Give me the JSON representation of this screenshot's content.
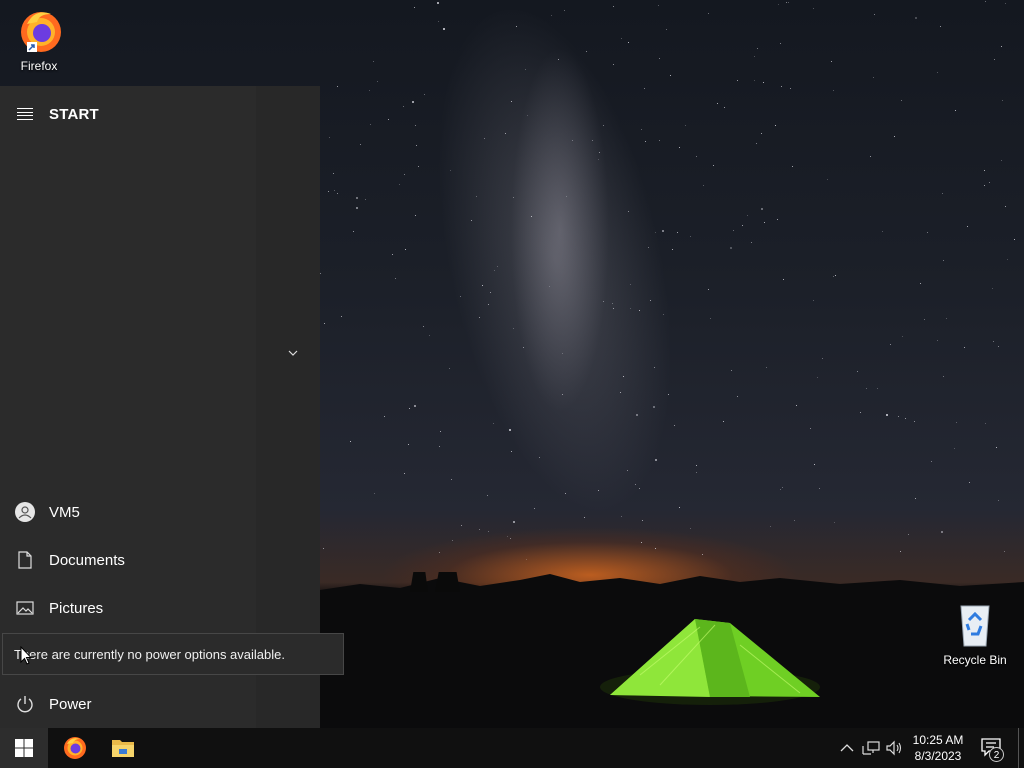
{
  "desktop": {
    "icons": [
      {
        "label": "Firefox"
      },
      {
        "label": "Recycle Bin"
      }
    ]
  },
  "start_menu": {
    "title": "START",
    "items": [
      {
        "label": "VM5",
        "icon": "user-icon"
      },
      {
        "label": "Documents",
        "icon": "document-icon"
      },
      {
        "label": "Pictures",
        "icon": "pictures-icon"
      },
      {
        "label": "Power",
        "icon": "power-icon"
      }
    ],
    "tooltip": "There are currently no power options available."
  },
  "taskbar": {
    "pinned": [
      {
        "name": "Firefox",
        "icon": "firefox-icon"
      },
      {
        "name": "File Explorer",
        "icon": "folder-icon"
      }
    ],
    "clock": {
      "time": "10:25 AM",
      "date": "8/3/2023"
    },
    "notification_count": "2"
  },
  "colors": {
    "start_menu_bg": "#2b2b2b",
    "taskbar_bg": "#101010",
    "tent_green": "#7ee02a"
  }
}
